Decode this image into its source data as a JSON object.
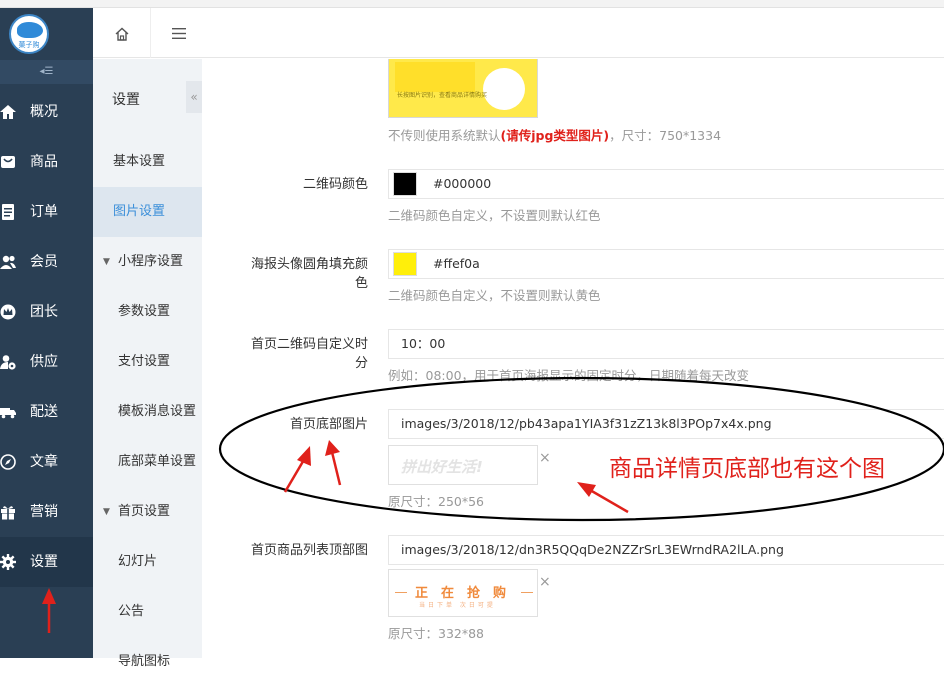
{
  "sidebar": {
    "logo_text": "菓子购",
    "collapse_glyph": "◂☰",
    "items": [
      {
        "label": "概况",
        "icon": "home-icon"
      },
      {
        "label": "商品",
        "icon": "goods-icon"
      },
      {
        "label": "订单",
        "icon": "order-icon"
      },
      {
        "label": "会员",
        "icon": "member-icon"
      },
      {
        "label": "团长",
        "icon": "crown-icon"
      },
      {
        "label": "供应",
        "icon": "supplier-icon"
      },
      {
        "label": "配送",
        "icon": "truck-icon"
      },
      {
        "label": "文章",
        "icon": "compass-icon"
      },
      {
        "label": "营销",
        "icon": "gift-icon"
      },
      {
        "label": "设置",
        "icon": "gear-icon"
      }
    ]
  },
  "header": {
    "home_icon": "home-outline-icon",
    "menu_icon": "hamburger-icon"
  },
  "subnav": {
    "title": "设置",
    "toggle": "«",
    "items": [
      {
        "label": "基本设置"
      },
      {
        "label": "图片设置"
      },
      {
        "label": "小程序设置",
        "caret": "▼"
      },
      {
        "label": "参数设置"
      },
      {
        "label": "支付设置"
      },
      {
        "label": "模板消息设置"
      },
      {
        "label": "底部菜单设置"
      },
      {
        "label": "首页设置",
        "caret": "▼"
      },
      {
        "label": "幻灯片"
      },
      {
        "label": "公告"
      },
      {
        "label": "导航图标"
      }
    ]
  },
  "form": {
    "poster_bg": {
      "preview_text": "长按图片识别，查看商品详情购买",
      "hint_pre": "不传则使用系统默认",
      "hint_red": "(请传jpg类型图片)",
      "hint_post": "，尺寸：750*1334"
    },
    "qrcode_color": {
      "label": "二维码颜色",
      "value": "#000000",
      "hint": "二维码颜色自定义，不设置则默认红色",
      "swatch": "#000000"
    },
    "avatar_fill": {
      "label": "海报头像圆角填充颜色",
      "value": "#ffef0a",
      "hint": "二维码颜色自定义，不设置则默认黄色",
      "swatch": "#ffef0a"
    },
    "qrcode_time": {
      "label": "首页二维码自定义时分",
      "value": "10：00",
      "hint": "例如：08:00，用于首页海报显示的固定时分，日期随着每天改变"
    },
    "bottom_image": {
      "label": "首页底部图片",
      "value": "images/3/2018/12/pb43apa1YIA3f31zZ13k8l3POp7x4x.png",
      "thumb_text": "拼出好生活!",
      "hint": "原尺寸：250*56",
      "remove": "×"
    },
    "list_top_image": {
      "label": "首页商品列表顶部图",
      "value": "images/3/2018/12/dn3R5QQqDe2NZZrSrL3EWrndRA2lLA.png",
      "thumb_chars": [
        "正",
        "在",
        "抢",
        "购"
      ],
      "thumb_sub": "当日下单 次日可提",
      "hint": "原尺寸：332*88",
      "remove": "×"
    }
  },
  "annotation": {
    "text": "商品详情页底部也有这个图",
    "color": "#e0211b"
  },
  "colors": {
    "sidebar_bg": "#2a3f54",
    "accent": "#3b8fd9",
    "annotation": "#e0211b"
  }
}
